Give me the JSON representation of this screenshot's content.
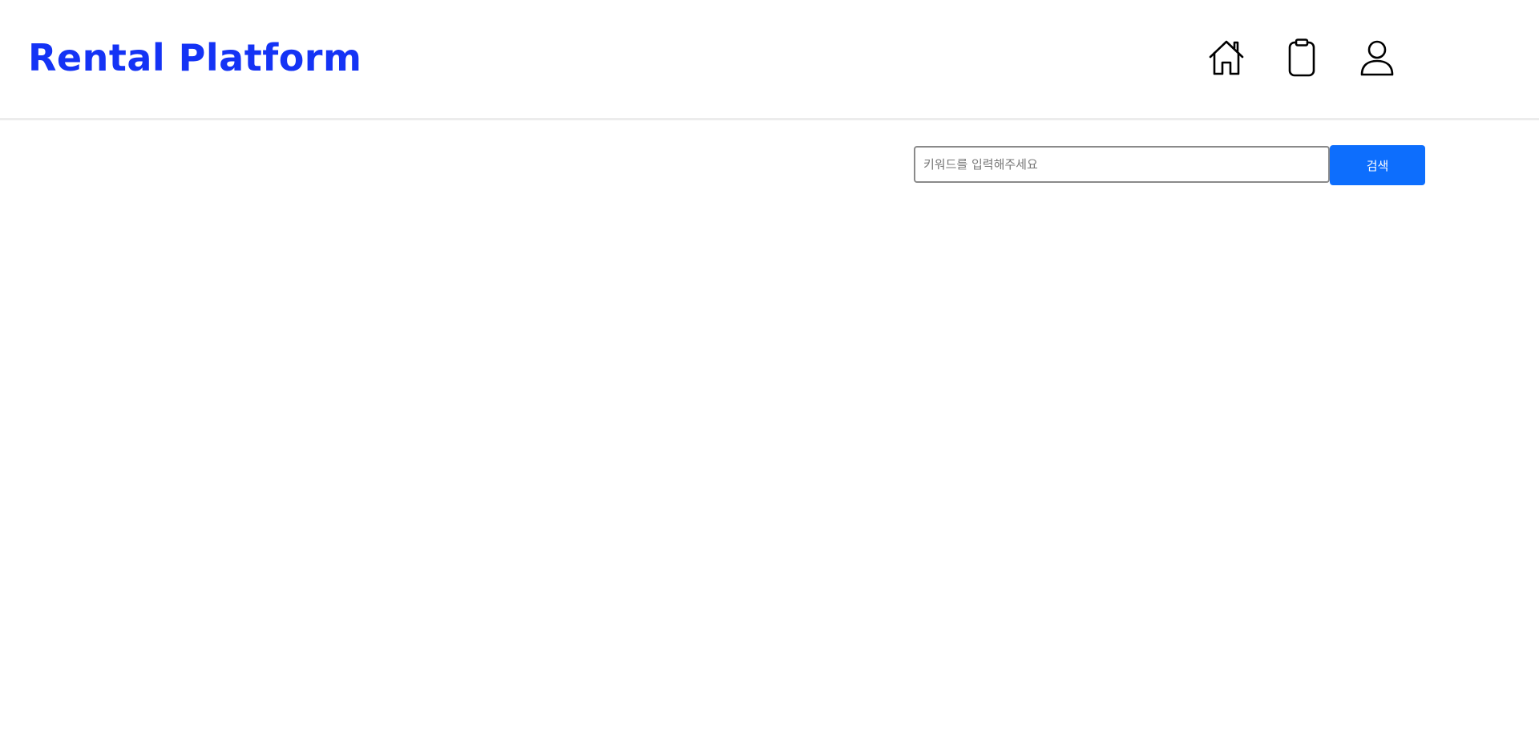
{
  "header": {
    "logo_text": "Rental Platform",
    "brand_color": "#1433f5",
    "nav": [
      {
        "icon": "home-icon"
      },
      {
        "icon": "clipboard-icon"
      },
      {
        "icon": "user-icon"
      }
    ]
  },
  "search": {
    "placeholder": "키워드를 입력해주세요",
    "value": "",
    "button_label": "검색",
    "button_color": "#0d6efd"
  }
}
